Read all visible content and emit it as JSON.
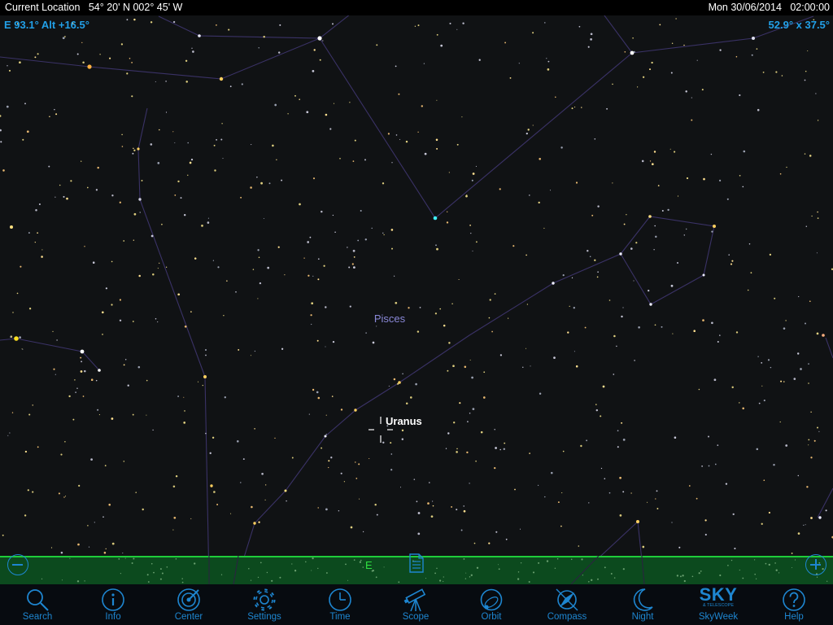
{
  "status_bar": {
    "location": "Current Location   54° 20' N 002° 45' W",
    "datetime": "Mon 30/06/2014   02:00:00"
  },
  "hud": {
    "pointing": "E 93.1° Alt +16.5°",
    "field_of_view": "52.9° x 37.5°"
  },
  "sky": {
    "constellation_label": "Pisces",
    "target_label": "Uranus",
    "compass_label": "E"
  },
  "colors": {
    "accent": "#1e86d0",
    "hud_text": "#22a0e8",
    "horizon_fill": "#0c4a1e",
    "horizon_line": "#1fcc3a",
    "constellation_label": "#8a88d8",
    "constellation_line": "#3a3266",
    "sky_bg": "#101214"
  },
  "toolbar": {
    "items": [
      {
        "label": "Search",
        "icon": "search-icon"
      },
      {
        "label": "Info",
        "icon": "info-icon"
      },
      {
        "label": "Center",
        "icon": "center-icon"
      },
      {
        "label": "Settings",
        "icon": "gear-icon"
      },
      {
        "label": "Time",
        "icon": "clock-icon"
      },
      {
        "label": "Scope",
        "icon": "telescope-icon"
      },
      {
        "label": "Orbit",
        "icon": "orbit-icon"
      },
      {
        "label": "Compass",
        "icon": "compass-icon"
      },
      {
        "label": "Night",
        "icon": "moon-icon"
      },
      {
        "label": "SkyWeek",
        "icon": "sky-telescope-logo"
      },
      {
        "label": "Help",
        "icon": "help-icon"
      }
    ],
    "skyweek_logo_text": "SKY",
    "skyweek_logo_subtext": "& TELESCOPE"
  }
}
